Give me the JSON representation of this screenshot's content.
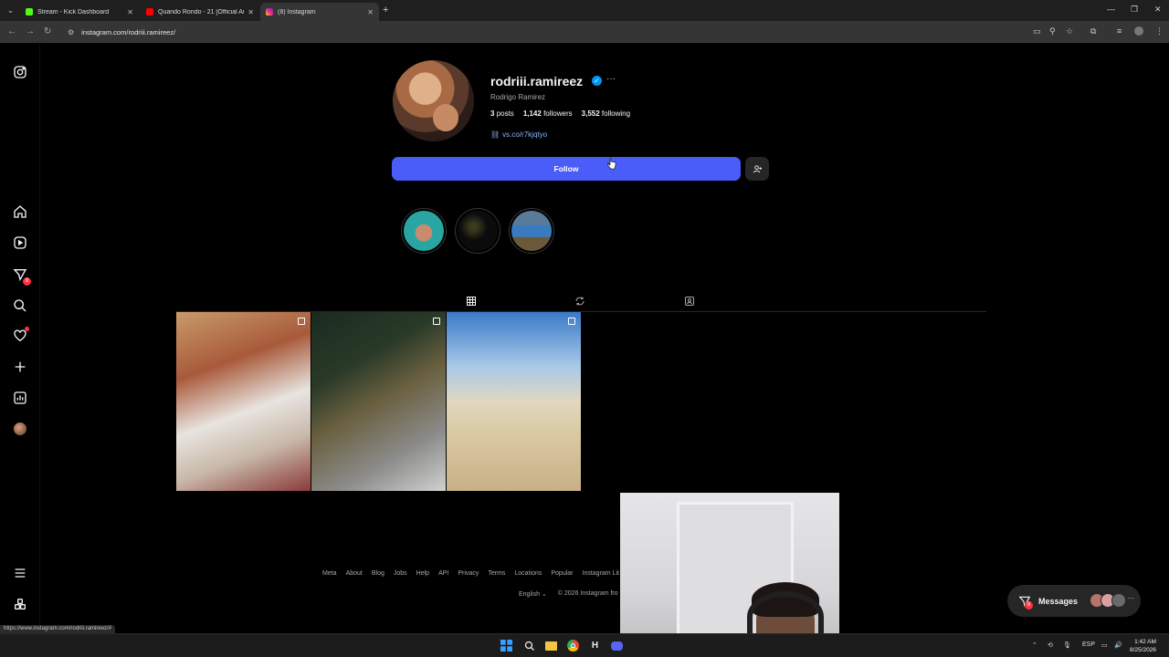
{
  "browser": {
    "tabs": [
      {
        "title": "Stream - Kick Dashboard",
        "favicon_color": "#53fc18",
        "active": false
      },
      {
        "title": "Quando Rondo - 21 [Official Au",
        "favicon_color": "#ff0000",
        "active": false
      },
      {
        "title": "(8) Instagram",
        "favicon_color": "#e1306c",
        "active": true
      }
    ],
    "url": "instagram.com/rodriii.ramireez/",
    "status_url": "https://www.instagram.com/rodriii.ramireez/#"
  },
  "profile": {
    "username": "rodriii.ramireez",
    "verified": true,
    "full_name": "Rodrigo Ramirez",
    "stats": {
      "posts_count": "3",
      "posts_label": "posts",
      "followers_count": "1,142",
      "followers_label": "followers",
      "following_count": "3,552",
      "following_label": "following"
    },
    "link": "vs.co/r7kjqtyo",
    "follow_label": "Follow",
    "highlights_count": 3,
    "posts_count": 3
  },
  "nav": {
    "notifications_badge": "8",
    "icons": [
      "instagram-icon",
      "home-icon",
      "reels-icon",
      "messages-icon",
      "search-icon",
      "notifications-icon",
      "create-icon",
      "dashboard-icon",
      "profile-icon",
      "more-icon",
      "also-from-meta-icon"
    ]
  },
  "footer": {
    "links": [
      "Meta",
      "About",
      "Blog",
      "Jobs",
      "Help",
      "API",
      "Privacy",
      "Terms",
      "Locations",
      "Popular",
      "Instagram Lit"
    ],
    "language": "English",
    "copyright": "© 2026 Instagram fro"
  },
  "messages": {
    "label": "Messages",
    "badge": "8"
  },
  "taskbar": {
    "language": "ESP",
    "time": "1:42 AM",
    "date": "8/25/2026"
  },
  "colors": {
    "accent": "#4a5df9",
    "verified": "#0095f6",
    "badge": "#ff3040",
    "link": "#8ab4ff"
  }
}
